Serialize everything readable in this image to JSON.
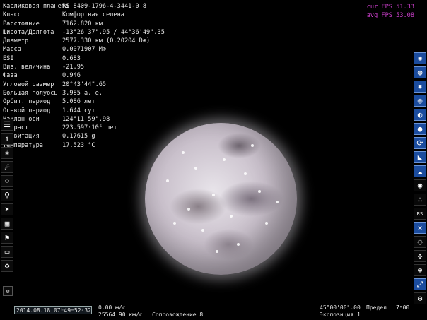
{
  "info": {
    "rows": [
      {
        "label": "Карликовая планета",
        "value": "RS 8409-1796-4-3441-0 8"
      },
      {
        "label": "Класс",
        "value": "Комфортная селена"
      },
      {
        "label": "Расстояние",
        "value": "7162.820 км"
      },
      {
        "label": "Широта/Долгота",
        "value": "-13°26'37\".95 / 44°36'49\".35"
      },
      {
        "label": "Диаметр",
        "value": "2577.330 км (0.20204 D⊕)"
      },
      {
        "label": "Масса",
        "value": "0.0071907 M⊕"
      },
      {
        "label": "ESI",
        "value": "0.683"
      },
      {
        "label": "Виз. величина",
        "value": "-21.95"
      },
      {
        "label": "Фаза",
        "value": "0.946"
      },
      {
        "label": "Угловой размер",
        "value": "20°43'44\".65"
      },
      {
        "label": "Большая полуось",
        "value": "3.985 а. е."
      },
      {
        "label": "Орбит. период",
        "value": "5.086 лет"
      },
      {
        "label": "Осевой период",
        "value": "1.644 сут"
      },
      {
        "label": "Наклон оси",
        "value": "124°11'59\".98"
      },
      {
        "label": "Возраст",
        "value": "223.597·10⁶ лет"
      },
      {
        "label": "Гравитация",
        "value": "0.17615 g"
      },
      {
        "label": "Температура",
        "value": "17.523 °C"
      }
    ]
  },
  "fps": {
    "cur": "cur FPS 51.33",
    "avg": "avg FPS 53.08",
    "color": "#d040d0"
  },
  "left_toolbar": [
    {
      "icon": "menu-icon",
      "glyph": "☰"
    },
    {
      "icon": "info-icon",
      "glyph": "i"
    },
    {
      "icon": "star-cluster-icon",
      "glyph": "✶"
    },
    {
      "icon": "comet-icon",
      "glyph": "☄"
    },
    {
      "icon": "star-field-icon",
      "glyph": "⁘"
    },
    {
      "icon": "search-icon",
      "glyph": "⚲"
    },
    {
      "icon": "ship-icon",
      "glyph": "➤"
    },
    {
      "icon": "calendar-icon",
      "glyph": "▦"
    },
    {
      "icon": "flag-icon",
      "glyph": "⚑"
    },
    {
      "icon": "monitor-icon",
      "glyph": "▭"
    },
    {
      "icon": "settings-icon",
      "glyph": "⚙"
    }
  ],
  "right_toolbar": [
    {
      "icon": "galaxy-icon",
      "glyph": "✺",
      "active": true
    },
    {
      "icon": "nebula-icon",
      "glyph": "◍",
      "active": true
    },
    {
      "icon": "sun-icon",
      "glyph": "✹",
      "active": true
    },
    {
      "icon": "orbit-icon",
      "glyph": "◎",
      "active": true
    },
    {
      "icon": "planet-ring-icon",
      "glyph": "◐",
      "active": true
    },
    {
      "icon": "moon-icon",
      "glyph": "●",
      "active": true
    },
    {
      "icon": "asteroid-icon",
      "glyph": "⟳",
      "active": true
    },
    {
      "icon": "tag-icon",
      "glyph": "◣",
      "active": true
    },
    {
      "icon": "cloud-icon",
      "glyph": "☁",
      "active": true
    },
    {
      "icon": "eye-icon",
      "glyph": "◉",
      "active": false
    },
    {
      "icon": "stars-labels-icon",
      "glyph": "∴",
      "active": false
    },
    {
      "icon": "rs-icon",
      "glyph": "RS",
      "active": false
    },
    {
      "icon": "grid-cross-icon",
      "glyph": "✕",
      "active": true
    },
    {
      "icon": "target-icon",
      "glyph": "◌",
      "active": false
    },
    {
      "icon": "compass-icon",
      "glyph": "✣",
      "active": false
    },
    {
      "icon": "globe-icon",
      "glyph": "⊕",
      "active": false
    },
    {
      "icon": "fullscreen-icon",
      "glyph": "⤢",
      "active": true
    },
    {
      "icon": "gear-icon",
      "glyph": "⚙",
      "active": false
    }
  ],
  "bottom": {
    "datetime": "2014.08.18 07ʰ49ᵐ52ˢ32",
    "speed1": "0.00 м/с",
    "speed2": "25564.90 км/с",
    "follow": "Сопровождение 8",
    "fov": "45°00'00\".00",
    "limit_label": "Предел",
    "limit_value": "7ᵐ00",
    "exposure": "Экспозиция 1"
  }
}
